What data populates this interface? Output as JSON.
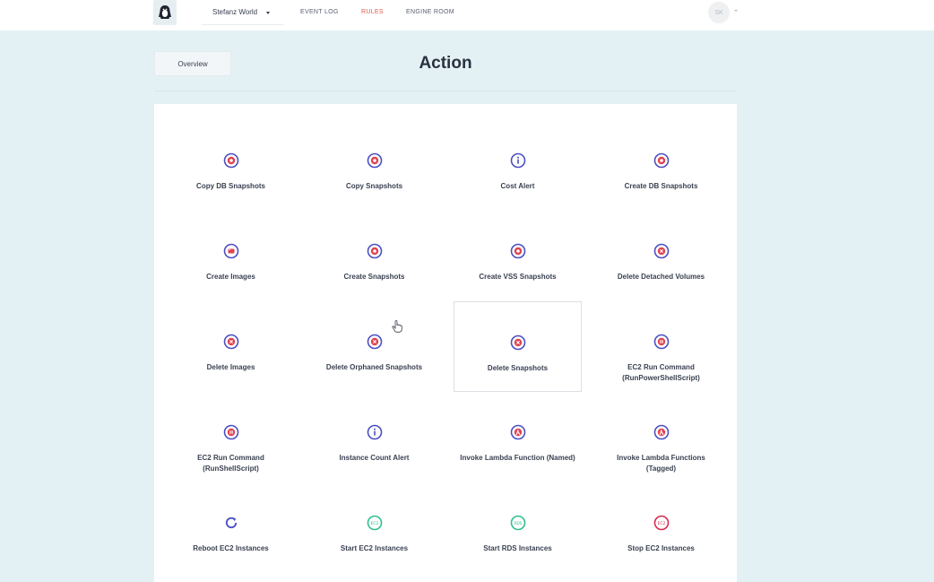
{
  "topbar": {
    "workspace": "Stefanz World",
    "nav": [
      {
        "label": "EVENT LOG",
        "active": false
      },
      {
        "label": "RULES",
        "active": true
      },
      {
        "label": "ENGINE ROOM",
        "active": false
      }
    ],
    "user_initials": "SK"
  },
  "page": {
    "overview_label": "Overview",
    "title": "Action"
  },
  "colors": {
    "accent": "#e05a4e",
    "icon_blue": "#4b4fc4",
    "icon_red": "#e0434f",
    "icon_green": "#2fbf8e",
    "icon_crimson": "#d8284f"
  },
  "actions": [
    {
      "label": "Copy DB Snapshots",
      "label2": "",
      "icon": "snapshot-icon"
    },
    {
      "label": "Copy Snapshots",
      "label2": "",
      "icon": "snapshot-icon"
    },
    {
      "label": "Cost Alert",
      "label2": "",
      "icon": "info-icon"
    },
    {
      "label": "Create DB Snapshots",
      "label2": "",
      "icon": "snapshot-icon"
    },
    {
      "label": "Create Images",
      "label2": "",
      "icon": "image-icon"
    },
    {
      "label": "Create Snapshots",
      "label2": "",
      "icon": "snapshot-icon"
    },
    {
      "label": "Create VSS Snapshots",
      "label2": "",
      "icon": "snapshot-icon"
    },
    {
      "label": "Delete Detached Volumes",
      "label2": "",
      "icon": "delete-icon"
    },
    {
      "label": "Delete Images",
      "label2": "",
      "icon": "delete-icon"
    },
    {
      "label": "Delete Orphaned Snapshots",
      "label2": "",
      "icon": "delete-icon"
    },
    {
      "label": "Delete Snapshots",
      "label2": "",
      "icon": "delete-icon"
    },
    {
      "label": "EC2 Run Command",
      "label2": "(RunPowerShellScript)",
      "icon": "run-command-icon"
    },
    {
      "label": "EC2 Run Command",
      "label2": "(RunShellScript)",
      "icon": "run-command-icon"
    },
    {
      "label": "Instance Count Alert",
      "label2": "",
      "icon": "info-icon"
    },
    {
      "label": "Invoke Lambda Function (Named)",
      "label2": "",
      "icon": "lambda-icon"
    },
    {
      "label": "Invoke Lambda Functions",
      "label2": "(Tagged)",
      "icon": "lambda-icon"
    },
    {
      "label": "Reboot EC2 Instances",
      "label2": "",
      "icon": "reboot-icon"
    },
    {
      "label": "Start EC2 Instances",
      "label2": "",
      "icon": "ec2-start-icon"
    },
    {
      "label": "Start RDS Instances",
      "label2": "",
      "icon": "rds-start-icon"
    },
    {
      "label": "Stop EC2 Instances",
      "label2": "",
      "icon": "ec2-stop-icon"
    }
  ]
}
